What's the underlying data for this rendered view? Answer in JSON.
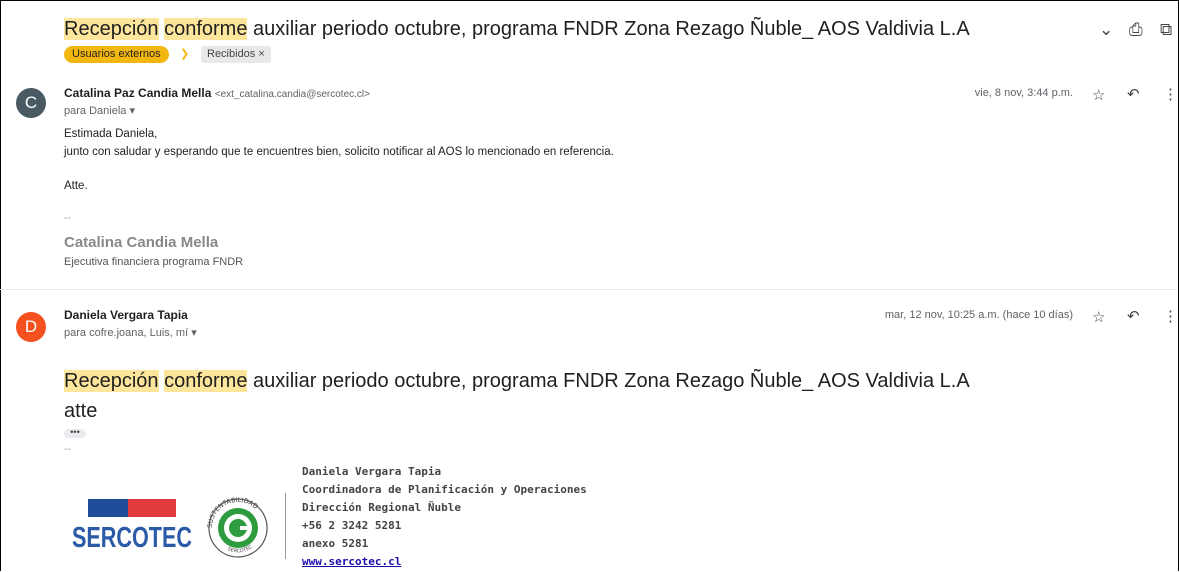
{
  "subject": {
    "hl1": "Recepción",
    "mid1": " ",
    "hl2": "conforme",
    "rest": " auxiliar periodo octubre, programa FNDR Zona Rezago Ñuble_ AOS Valdivia L.A"
  },
  "labels": {
    "external": "Usuarios externos",
    "inbox": "Recibidos",
    "inbox_close": "×",
    "arrow": "❯"
  },
  "top_icons": {
    "collapse": "⌄",
    "print": "⎙",
    "popout": "⧉"
  },
  "msg1": {
    "avatar": "C",
    "avatar_color": "#4a5a63",
    "sender": "Catalina Paz Candia Mella",
    "email": "<ext_catalina.candia@sercotec.cl>",
    "to": "para Daniela",
    "date": "vie, 8 nov, 3:44 p.m.",
    "body": [
      "Estimada Daniela,",
      "junto con saludar y esperando que te encuentres bien, solicito notificar al AOS lo mencionado en referencia.",
      "Atte."
    ],
    "sig_dash": "--",
    "sig_name": "Catalina Candia Mella",
    "sig_role": "Ejecutiva financiera programa FNDR"
  },
  "msg2": {
    "avatar": "D",
    "avatar_color": "#f4511e",
    "sender": "Daniela Vergara Tapia",
    "to": "para cofre.joana, Luis, mí",
    "date": "mar, 12 nov, 10:25 a.m. (hace 10 días)",
    "body_atte": "atte",
    "dots": "•••",
    "sig_dash": "--",
    "signature": [
      "Daniela Vergara Tapia",
      "Coordinadora de Planificación y Operaciones",
      "Dirección Regional Ñuble",
      "+56 2 3242 5281",
      "anexo 5281"
    ],
    "website": "www.sercotec.cl",
    "logo_text": "SERCOTEC",
    "seal_top": "SUSTENTABILIDAD",
    "seal_bottom": "SERCOTEC"
  },
  "actions": {
    "star": "☆",
    "reply": "↶",
    "more": "⋮"
  },
  "colors": {
    "highlight": "#fde59b",
    "label": "#f3b712",
    "logo_blue": "#1f4c9a",
    "logo_red": "#e03a3e",
    "seal_green": "#2e9b3e"
  }
}
